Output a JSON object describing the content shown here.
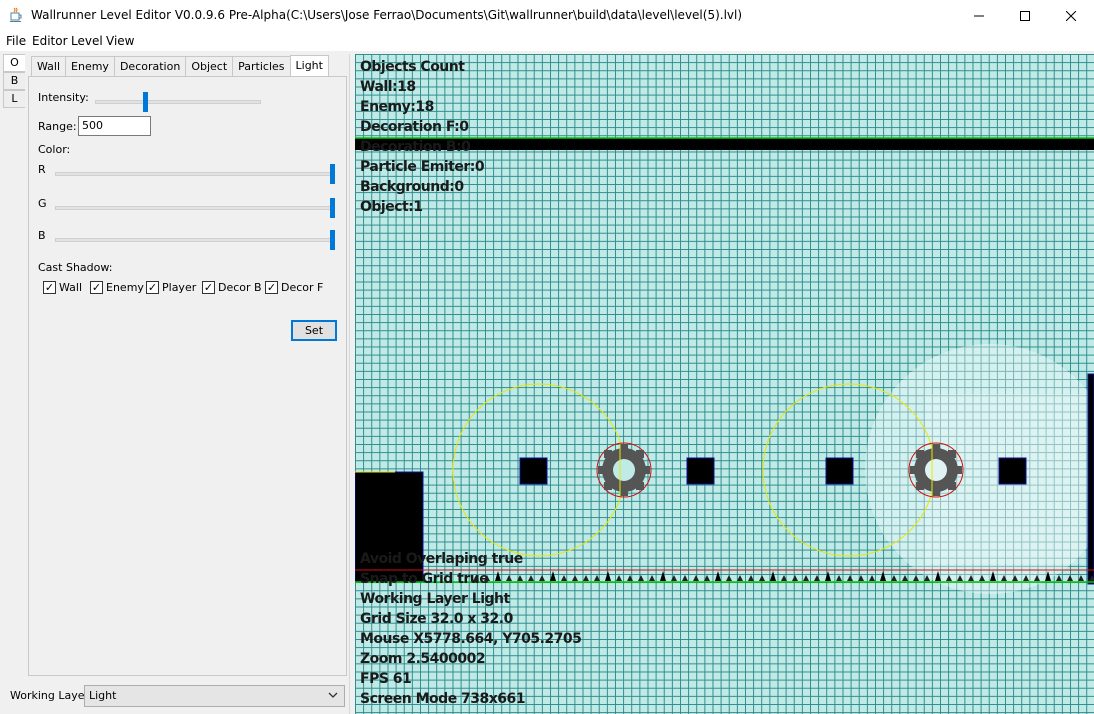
{
  "window": {
    "title": "Wallrunner Level Editor V0.0.9.6 Pre-Alpha(C:\\Users\\Jose Ferrao\\Documents\\Git\\wallrunner\\build\\data\\level\\level(5).lvl)",
    "app_icon": "java-cup-icon"
  },
  "menu": {
    "file": "File",
    "editor": "Editor",
    "level": "Level",
    "view": "View"
  },
  "side_tabs": [
    "O",
    "B",
    "L"
  ],
  "tabs": [
    "Wall",
    "Enemy",
    "Decoration",
    "Object",
    "Particles",
    "Light"
  ],
  "light": {
    "intensity_label": "Intensity:",
    "intensity_value": 0.3,
    "range_label": "Range:",
    "range_value": "500",
    "color_label": "Color:",
    "r_label": "R",
    "g_label": "G",
    "b_label": "B",
    "r_value": 1.0,
    "g_value": 1.0,
    "b_value": 1.0,
    "cast_shadow_label": "Cast Shadow:",
    "checks": [
      {
        "label": "Wall",
        "checked": true
      },
      {
        "label": "Enemy",
        "checked": true
      },
      {
        "label": "Player",
        "checked": true
      },
      {
        "label": "Decor B",
        "checked": true
      },
      {
        "label": "Decor F",
        "checked": true
      }
    ],
    "set_label": "Set"
  },
  "working_layer": {
    "label": "Working Layer",
    "value": "Light"
  },
  "canvas": {
    "info_top": [
      "Objects Count",
      "Wall:18",
      "Enemy:18",
      "Decoration F:0",
      "Decoration B:0",
      "Particle Emiter:0",
      "Background:0",
      "Object:1"
    ],
    "info_bottom": [
      "Avoid Overlaping true",
      "Snap to Grid true",
      "Working Layer Light",
      "Grid Size 32.0 x 32.0",
      "Mouse X5778.664, Y705.2705",
      "Zoom 2.5400002",
      "FPS 61",
      "Screen Mode 738x661"
    ],
    "colors": {
      "grid_bg": "#bfeae6",
      "grid_line": "#2f8a8f",
      "wall": "#000000",
      "light_circle": "#e8e800",
      "enemy_circle": "#d01010",
      "ground_line": "#00c800"
    }
  }
}
